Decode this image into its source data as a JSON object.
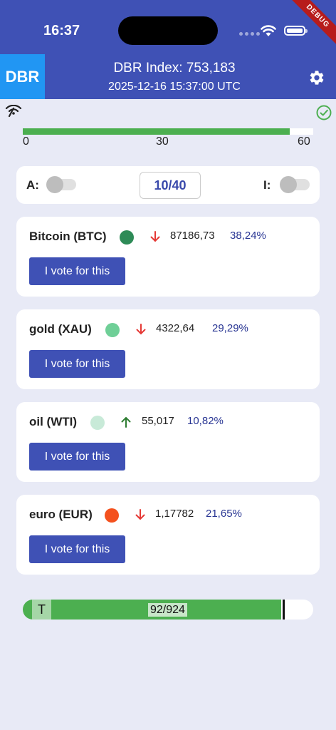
{
  "status_bar": {
    "time": "16:37"
  },
  "debug_banner": "DEBUG",
  "app_bar": {
    "logo": "DBR",
    "index_title": "DBR Index: 753,183",
    "timestamp": "2025-12-16 15:37:00 UTC",
    "settings_icon": "gear-icon"
  },
  "connection": {
    "left_icon": "signal-icon",
    "right_icon": "check-circle-icon"
  },
  "timeline": {
    "progress": 0.92,
    "ticks": [
      "0",
      "30",
      "60"
    ],
    "fill_color": "#4caf50"
  },
  "controls": {
    "toggle_a_label": "A:",
    "toggle_a_on": false,
    "counter": "10/40",
    "toggle_i_label": "I:",
    "toggle_i_on": false
  },
  "assets": [
    {
      "name": "Bitcoin (BTC)",
      "color": "#2e8b57",
      "trend": "down",
      "price": "87186,73",
      "share": "38,24%",
      "button": "I vote for this"
    },
    {
      "name": "gold (XAU)",
      "color": "#6fcf97",
      "trend": "down",
      "price": "4322,64",
      "share": "29,29%",
      "button": "I vote for this"
    },
    {
      "name": "oil (WTI)",
      "color": "#c8ead8",
      "trend": "up",
      "price": "55,017",
      "share": "10,82%",
      "button": "I vote for this"
    },
    {
      "name": "euro (EUR)",
      "color": "#f4511e",
      "trend": "down",
      "price": "1,17782",
      "share": "21,65%",
      "button": "I vote for this"
    }
  ],
  "total": {
    "label": "T",
    "count": "92/924",
    "progress": 0.89
  },
  "colors": {
    "primary": "#3f51b5",
    "success": "#4caf50",
    "down": "#e53935",
    "up": "#2e7d32"
  }
}
